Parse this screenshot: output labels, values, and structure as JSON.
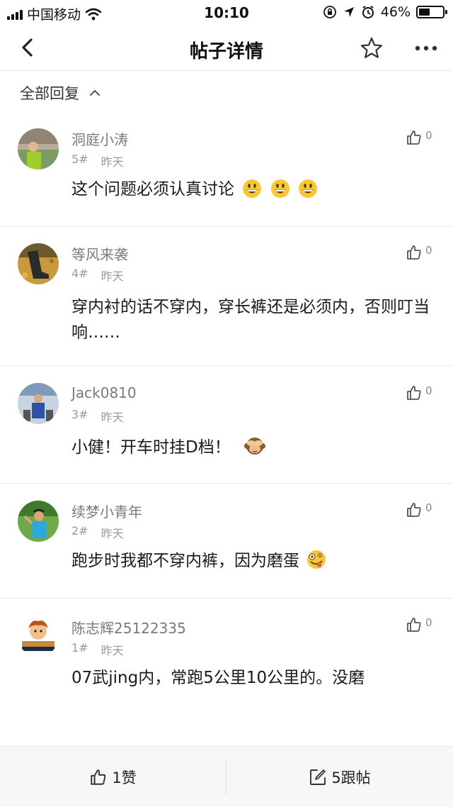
{
  "status": {
    "carrier": "中国移动",
    "time": "10:10",
    "battery": "46%",
    "battery_level": 0.46
  },
  "nav": {
    "title": "帖子详情",
    "back_icon": "chevron-left-icon",
    "star_icon": "star-outline-icon",
    "more_icon": "more-horizontal-icon"
  },
  "section": {
    "title": "全部回复"
  },
  "replies": [
    {
      "username": "洞庭小涛",
      "floor": "5#",
      "time": "昨天",
      "content": "这个问题必须认真讨论",
      "likes": "0",
      "emoji": [
        "grinning",
        "grinning",
        "grinning"
      ]
    },
    {
      "username": "等风来袭",
      "floor": "4#",
      "time": "昨天",
      "content": "穿内衬的话不穿内，穿长裤还是必须内，否则叮当响……",
      "likes": "0"
    },
    {
      "username": "Jack0810",
      "floor": "3#",
      "time": "昨天",
      "content": "小健！开车时挂D档！",
      "likes": "0",
      "emoji": [
        "see-no-evil-monkey"
      ]
    },
    {
      "username": "续梦小青年",
      "floor": "2#",
      "time": "昨天",
      "content": "跑步时我都不穿内裤，因为磨蛋",
      "likes": "0",
      "emoji": [
        "zany-face"
      ]
    },
    {
      "username": "陈志辉25122335",
      "floor": "1#",
      "time": "昨天",
      "content": "07武jing内，常跑5公里10公里的。没磨",
      "likes": "0"
    }
  ],
  "bottom": {
    "like_label": "1赞",
    "reply_label": "5跟帖"
  },
  "colors": {
    "username": "#7a7a7a",
    "meta": "#9a9a9a",
    "divider": "#e8e8e8",
    "bottom_bg": "#f7f7f7"
  }
}
